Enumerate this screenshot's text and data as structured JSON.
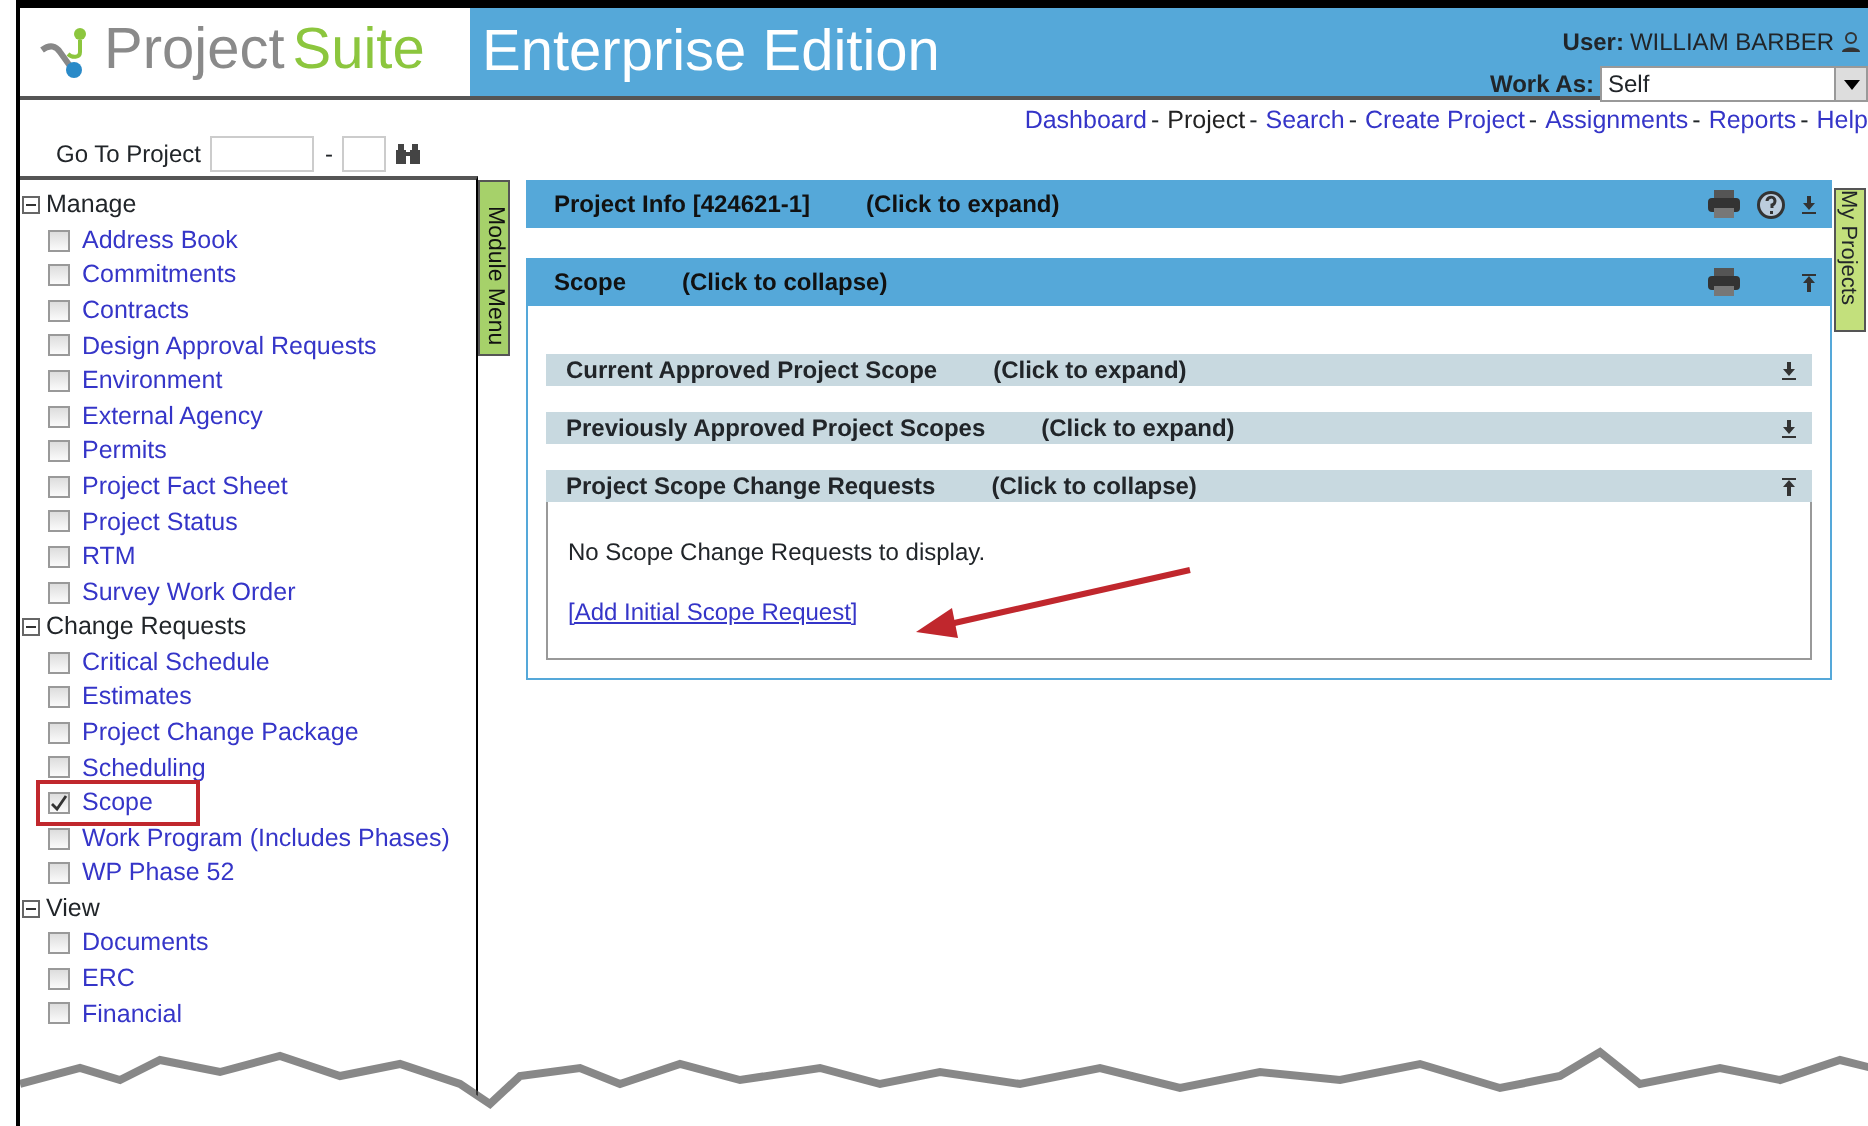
{
  "header": {
    "logo": {
      "part_1": "Project",
      "part_2": "Suite"
    },
    "edition": "Enterprise Edition",
    "user_label": "User:",
    "user_name": "WILLIAM BARBER",
    "work_as_label": "Work As:",
    "work_as_value": "Self"
  },
  "go_to_project": {
    "label": "Go To Project",
    "separator": "-"
  },
  "nav": [
    {
      "label": "Dashboard",
      "selected": false,
      "separator": "-"
    },
    {
      "label": "Project",
      "selected": true,
      "separator": "-"
    },
    {
      "label": "Search",
      "selected": false,
      "separator": "-"
    },
    {
      "label": "Create Project",
      "selected": false,
      "separator": "-"
    },
    {
      "label": "Assignments",
      "selected": false,
      "separator": "-"
    },
    {
      "label": "Reports",
      "selected": false,
      "separator": "-"
    },
    {
      "label": "Help",
      "selected": false
    }
  ],
  "sidebar": {
    "groups": [
      {
        "label": "Manage",
        "expanded": true,
        "items": [
          {
            "label": "Address Book",
            "checked": false,
            "highlighted": false
          },
          {
            "label": "Commitments",
            "checked": false,
            "highlighted": false
          },
          {
            "label": "Contracts",
            "checked": false,
            "highlighted": false
          },
          {
            "label": "Design Approval Requests",
            "checked": false,
            "highlighted": false
          },
          {
            "label": "Environment",
            "checked": false,
            "highlighted": false
          },
          {
            "label": "External Agency",
            "checked": false,
            "highlighted": false
          },
          {
            "label": "Permits",
            "checked": false,
            "highlighted": false
          },
          {
            "label": "Project Fact Sheet",
            "checked": false,
            "highlighted": false
          },
          {
            "label": "Project Status",
            "checked": false,
            "highlighted": false
          },
          {
            "label": "RTM",
            "checked": false,
            "highlighted": false
          },
          {
            "label": "Survey Work Order",
            "checked": false,
            "highlighted": false
          }
        ]
      },
      {
        "label": "Change Requests",
        "expanded": true,
        "items": [
          {
            "label": "Critical Schedule",
            "checked": false,
            "highlighted": false
          },
          {
            "label": "Estimates",
            "checked": false,
            "highlighted": false
          },
          {
            "label": "Project Change Package",
            "checked": false,
            "highlighted": false
          },
          {
            "label": "Scheduling",
            "checked": false,
            "highlighted": false
          },
          {
            "label": "Scope",
            "checked": true,
            "highlighted": true
          },
          {
            "label": "Work Program (Includes Phases)",
            "checked": false,
            "highlighted": false
          },
          {
            "label": "WP Phase 52",
            "checked": false,
            "highlighted": false
          }
        ]
      },
      {
        "label": "View",
        "expanded": true,
        "items": [
          {
            "label": "Documents",
            "checked": false,
            "highlighted": false
          },
          {
            "label": "ERC",
            "checked": false,
            "highlighted": false
          },
          {
            "label": "Financial",
            "checked": false,
            "highlighted": false
          }
        ]
      }
    ]
  },
  "module_menu_tab": "Module Menu",
  "my_projects_tab": "My Projects",
  "panels": [
    {
      "title": "Project Info [424621-1]",
      "hint": "(Click to expand)",
      "expanded": false,
      "help": true
    },
    {
      "title": "Scope",
      "hint": "(Click to collapse)",
      "expanded": true,
      "help": false,
      "sections": [
        {
          "title": "Current Approved Project Scope",
          "hint": "(Click to expand)",
          "expanded": false
        },
        {
          "title": "Previously Approved Project Scopes",
          "hint": "(Click to expand)",
          "expanded": false
        },
        {
          "title": "Project Scope Change Requests",
          "hint": "(Click to collapse)",
          "expanded": true,
          "message": "No Scope Change Requests to display.",
          "link": "[Add Initial Scope Request]"
        }
      ]
    }
  ]
}
